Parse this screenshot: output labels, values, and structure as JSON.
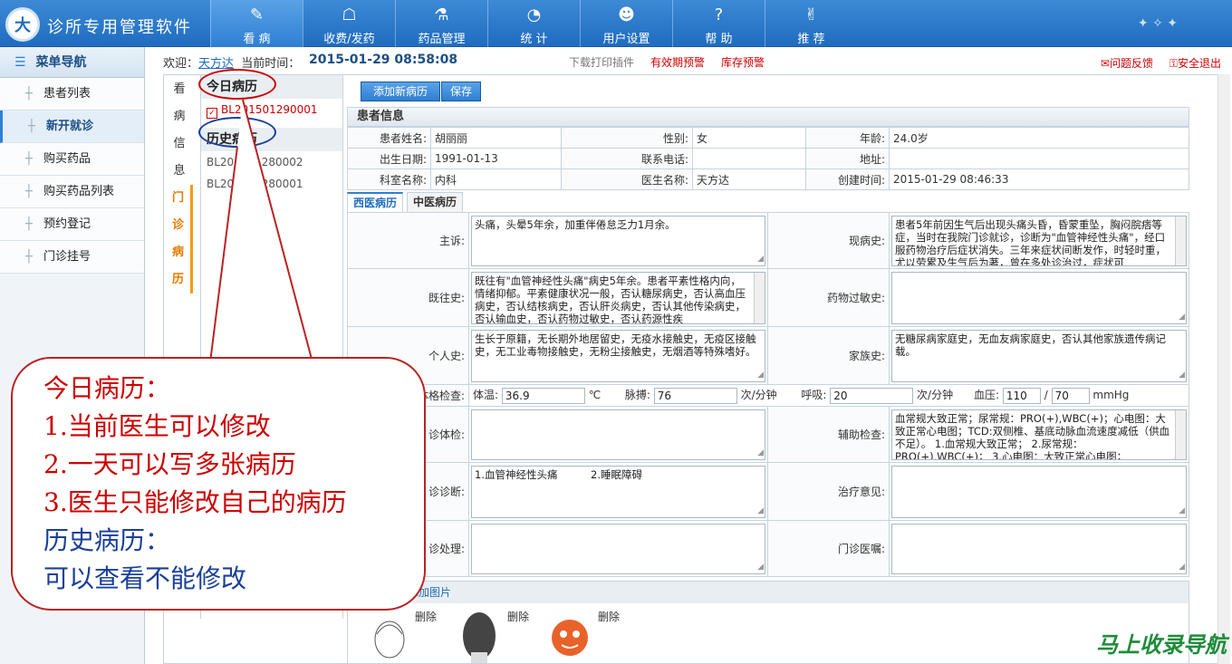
{
  "app": {
    "logo_text": "大",
    "title": "诊所专用管理软件"
  },
  "nav": [
    {
      "label": "看 病",
      "icon": "feather-icon"
    },
    {
      "label": "收费/发药",
      "icon": "cashier-icon"
    },
    {
      "label": "药品管理",
      "icon": "flask-icon"
    },
    {
      "label": "统 计",
      "icon": "pie-chart-icon"
    },
    {
      "label": "用户设置",
      "icon": "users-icon"
    },
    {
      "label": "帮 助",
      "icon": "help-icon"
    },
    {
      "label": "推 荐",
      "icon": "thumbs-up-icon"
    }
  ],
  "sidebar": {
    "title": "菜单导航",
    "items": [
      {
        "label": "患者列表"
      },
      {
        "label": "新开就诊"
      },
      {
        "label": "购买药品"
      },
      {
        "label": "购买药品列表"
      },
      {
        "label": "预约登记"
      },
      {
        "label": "门诊挂号"
      }
    ]
  },
  "welcome": {
    "prefix": "欢迎：",
    "username": "天方达",
    "time_label": "当前时间：",
    "datetime": "2015-01-29  08:58:08",
    "download": "下载打印插件",
    "expiry_warning": "有效期预警",
    "stock_warning": "库存预警",
    "feedback": "问题反馈",
    "logout": "安全退出"
  },
  "vtabs": [
    "看",
    "病",
    "信",
    "息",
    "门",
    "诊",
    "病",
    "历"
  ],
  "records": {
    "today_title": "今日病历",
    "today": [
      "BL201501290001"
    ],
    "history_title": "历史病历",
    "history": [
      "BL201501280002",
      "BL201501280001"
    ]
  },
  "buttons": {
    "add": "添加新病历",
    "save": "保存"
  },
  "patient": {
    "section": "患者信息",
    "name_label": "患者姓名:",
    "name": "胡丽丽",
    "sex_label": "性别:",
    "sex": "女",
    "age_label": "年龄:",
    "age": "24.0岁",
    "dob_label": "出生日期:",
    "dob": "1991-01-13",
    "phone_label": "联系电话:",
    "phone": "",
    "addr_label": "地址:",
    "addr": "",
    "dept_label": "科室名称:",
    "dept": "内科",
    "doctor_label": "医生名称:",
    "doctor": "天方达",
    "created_label": "创建时间:",
    "created": "2015-01-29 08:46:33"
  },
  "record_tabs": [
    "西医病历",
    "中医病历"
  ],
  "medical": {
    "chief_label": "主诉:",
    "chief": "头痛，头晕5年余，加重伴倦怠乏力1月余。",
    "present_label": "现病史:",
    "present": "患者5年前因生气后出现头痛头昏，昏蒙重坠，胸闷脘痞等症，当时在我院门诊就诊，诊断为\"血管神经性头痛\"，经口服药物治疗后症状消失。三年来症状间断发作，时轻时重，尤以劳累及生气后为著，曾在多处诊治过，症状可",
    "past_label": "既往史:",
    "past": "既往有\"血管神经性头痛\"病史5年余。患者平素性格内向，情绪抑郁。平素健康状况一般，否认糖尿病史，否认高血压病史，否认结核病史，否认肝炎病史，否认其他传染病史，否认输血史，否认药物过敏史，否认药源性疾",
    "allergy_label": "药物过敏史:",
    "allergy": "",
    "personal_label": "个人史:",
    "personal": "生长于原籍，无长期外地居留史，无疫水接触史，无疫区接触史，无工业毒物接触史，无粉尘接触史，无烟酒等特殊嗜好。",
    "family_label": "家族史:",
    "family": "无糖尿病家庭史，无血友病家庭史，否认其他家族遗传病记载。",
    "vitals_label": "体格检查:",
    "temp_label": "体温:",
    "temp": "36.9",
    "temp_unit": "℃",
    "pulse_label": "脉搏:",
    "pulse": "76",
    "pulse_unit": "次/分钟",
    "resp_label": "呼吸:",
    "resp": "20",
    "resp_unit": "次/分钟",
    "bp_label": "血压:",
    "bp_sys": "110",
    "bp_sep": "/",
    "bp_dia": "70",
    "bp_unit": "mmHg",
    "exam_label": "诊体检:",
    "exam": "",
    "aux_label": "辅助检查:",
    "aux": "血常规大致正常；尿常规：PRO(+),WBC(+)；心电图：大致正常心电图；TCD:双侧椎、基底动脉血流速度减低（供血不足）。 1.血常规大致正常；   2.尿常规：PRO(+),WBC(+)；   3.心电图：大致正常心电图；",
    "diag_label": "诊诊断:",
    "diag": "1.血管神经性头痛          2.睡眠障碍",
    "treat_label": "治疗意见:",
    "treat": "",
    "handle_label": "诊处理:",
    "handle": "",
    "advice_label": "门诊医嘱:",
    "advice": ""
  },
  "photos": {
    "add": "添加图片",
    "delete": "删除"
  },
  "callout": {
    "line1": "今日病历：",
    "line2": "1.当前医生可以修改",
    "line3": "2.一天可以写多张病历",
    "line4": "3.医生只能修改自己的病历",
    "line5": "历史病历：",
    "line6": "可以查看不能修改"
  },
  "watermark": "马上收录导航",
  "colors": {
    "header": "#1f6cc0",
    "accent": "#2e7fd3",
    "warning": "#cc0000",
    "active_tab": "#f39c12"
  }
}
